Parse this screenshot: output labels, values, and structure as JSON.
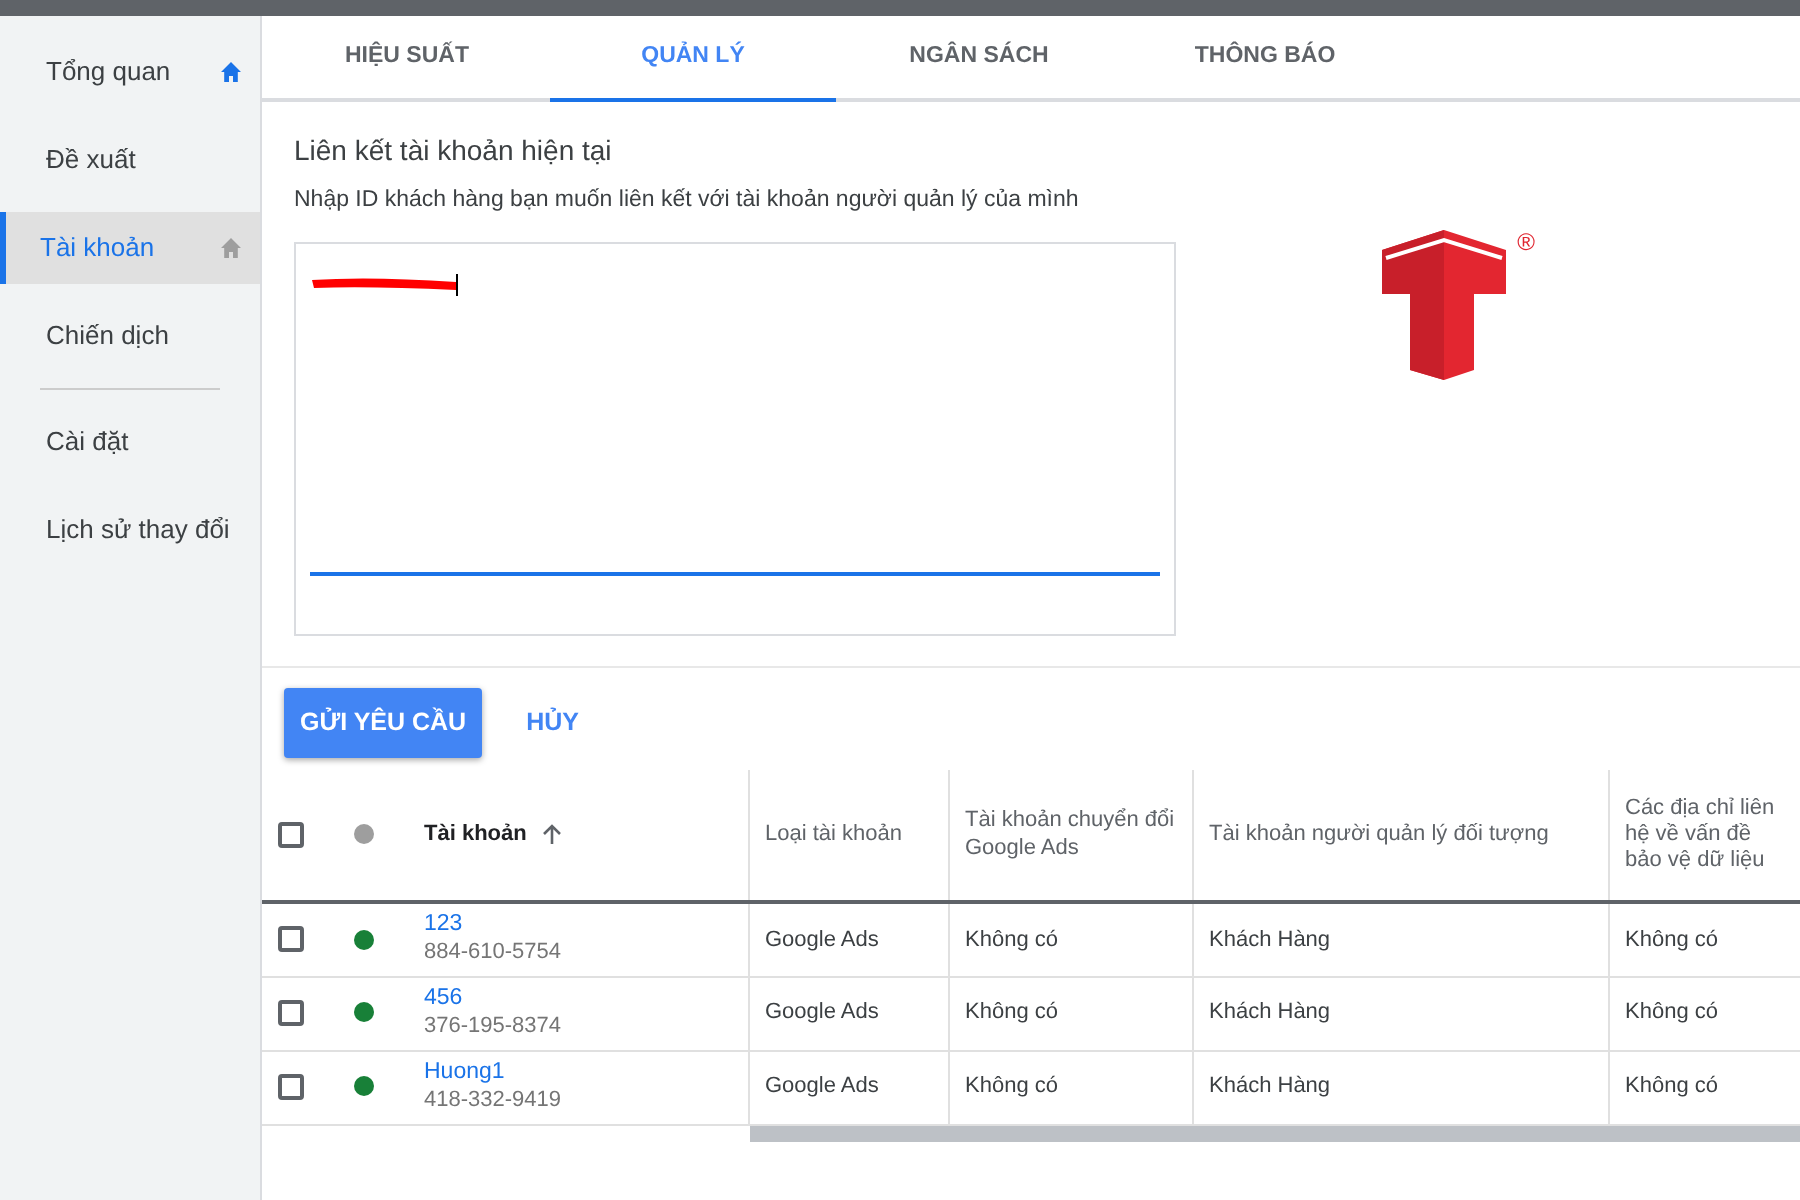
{
  "sidebar": {
    "items": [
      {
        "label": "Tổng quan",
        "selected": false,
        "home_icon": true
      },
      {
        "label": "Đề xuất",
        "selected": false,
        "home_icon": false
      },
      {
        "label": "Tài khoản",
        "selected": true,
        "home_icon": true
      },
      {
        "label": "Chiến dịch",
        "selected": false,
        "home_icon": false,
        "divider_after": true
      },
      {
        "label": "Cài đặt",
        "selected": false,
        "home_icon": false
      },
      {
        "label": "Lịch sử thay đổi",
        "selected": false,
        "home_icon": false
      }
    ]
  },
  "tabs": [
    {
      "label": "HIỆU SUẤT",
      "selected": false
    },
    {
      "label": "QUẢN LÝ",
      "selected": true
    },
    {
      "label": "NGÂN SÁCH",
      "selected": false
    },
    {
      "label": "THÔNG BÁO",
      "selected": false
    }
  ],
  "link_form": {
    "title": "Liên kết tài khoản hiện tại",
    "subtitle": "Nhập ID khách hàng bạn muốn liên kết với tài khoản người quản lý của mình",
    "input_redacted": true
  },
  "logo": {
    "registered_mark": "®"
  },
  "buttons": [
    {
      "label": "GỬI YÊU CẦU",
      "kind": "primary"
    },
    {
      "label": "HỦY",
      "kind": "text"
    }
  ],
  "table": {
    "select_all_checked": false,
    "columns": [
      "Tài khoản",
      "Loại tài khoản",
      "Tài khoản chuyển đổi Google Ads",
      "Tài khoản người quản lý đối tượng",
      "Các địa chỉ liên hệ về vấn đề bảo vệ dữ liệu"
    ],
    "rows": [
      {
        "checked": false,
        "color": "#188038",
        "name": "123",
        "id": "884-610-5754",
        "type": "Google Ads",
        "conversion": "Không có",
        "manager": "Khách Hàng",
        "contacts": "Không có"
      },
      {
        "checked": false,
        "color": "#188038",
        "name": "456",
        "id": "376-195-8374",
        "type": "Google Ads",
        "conversion": "Không có",
        "manager": "Khách Hàng",
        "contacts": "Không có"
      },
      {
        "checked": false,
        "color": "#188038",
        "name": "Huong1",
        "id": "418-332-9419",
        "type": "Google Ads",
        "conversion": "Không có",
        "manager": "Khách Hàng",
        "contacts": "Không có"
      }
    ]
  }
}
